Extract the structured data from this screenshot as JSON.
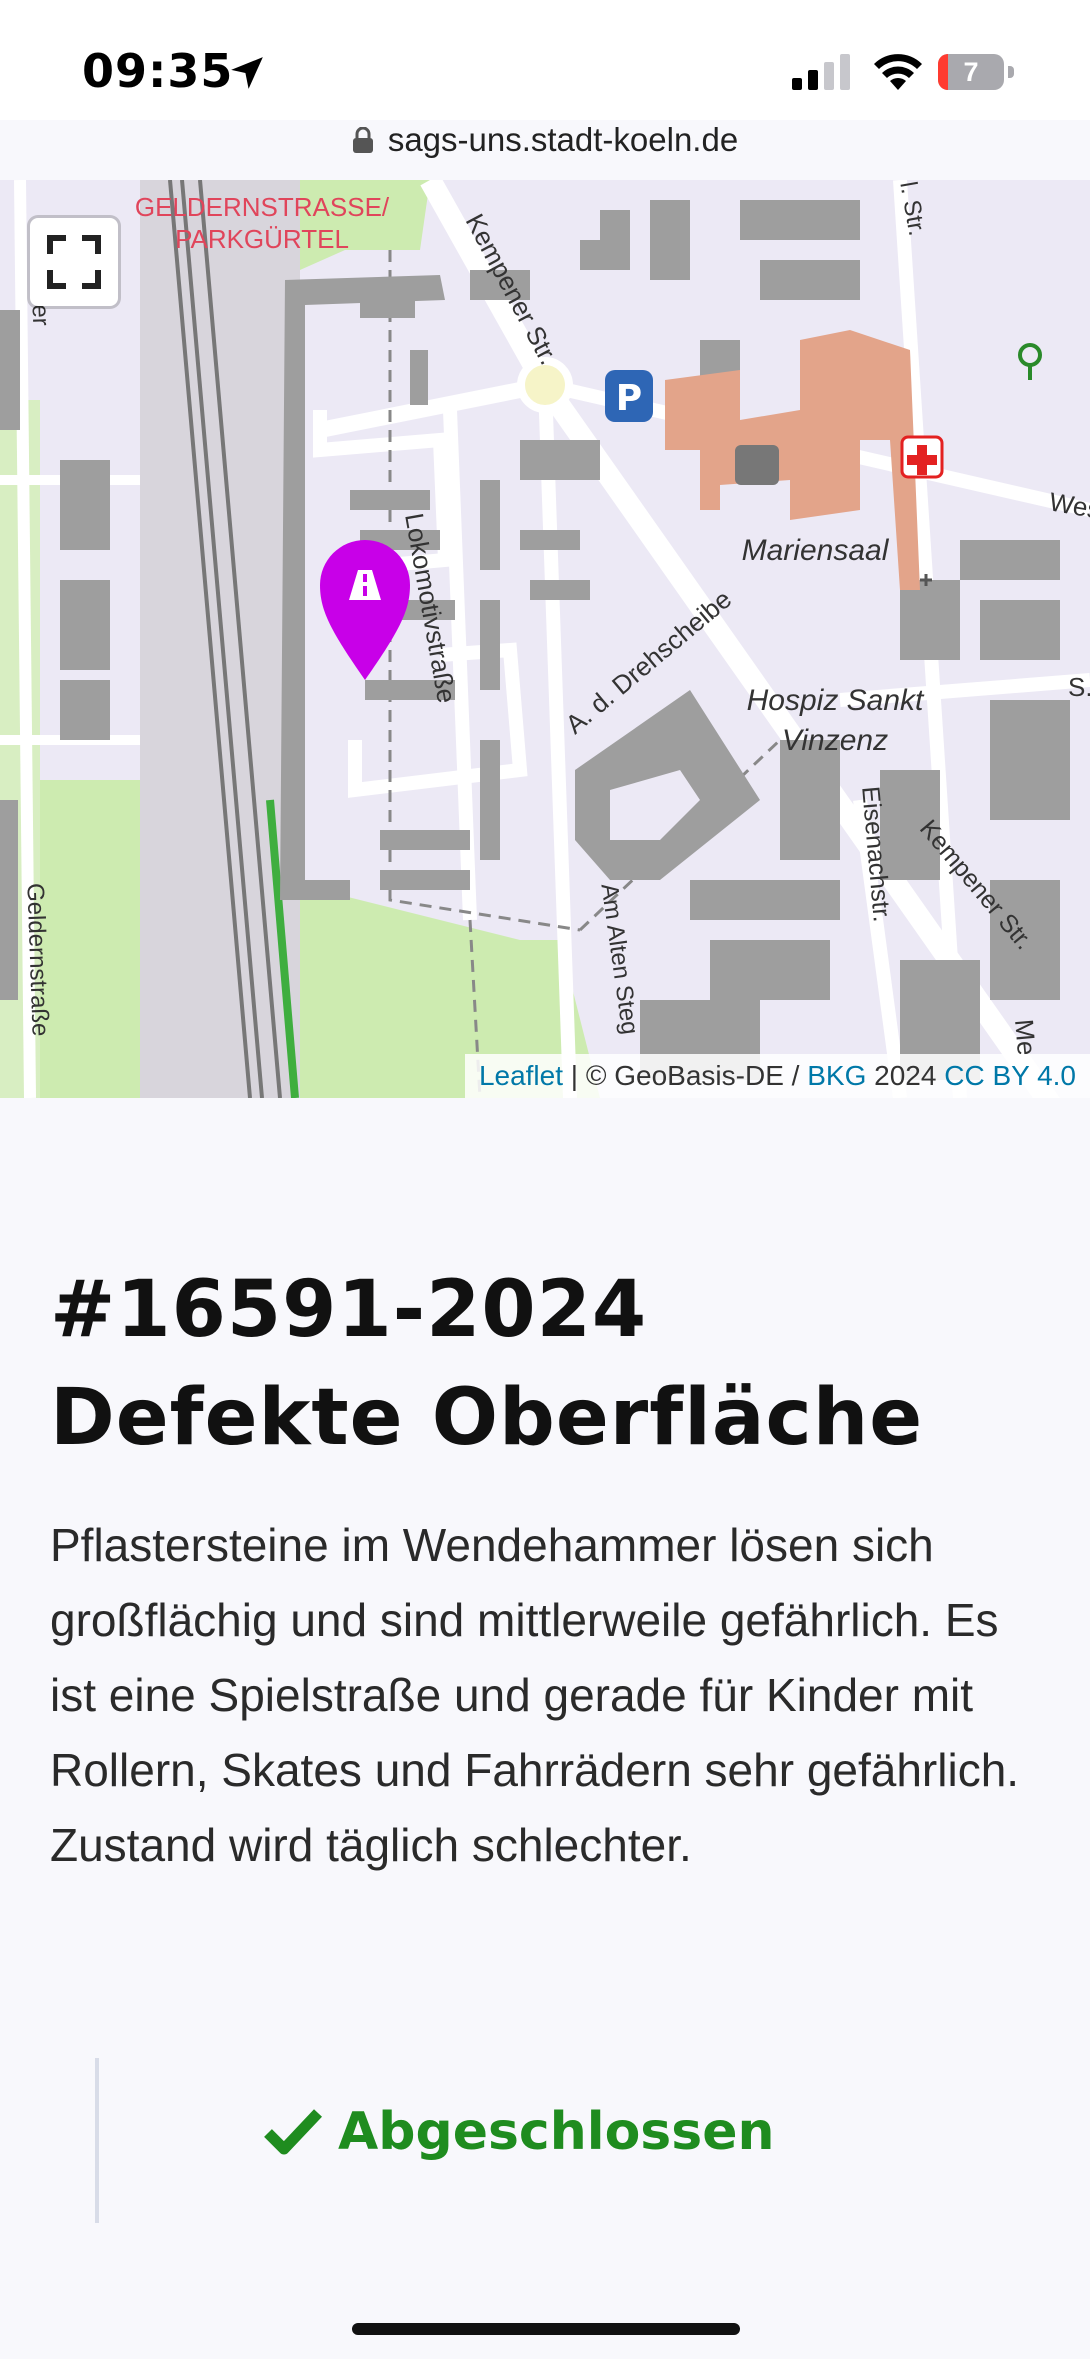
{
  "status_bar": {
    "time": "09:35",
    "battery": "7",
    "icons": [
      "location-arrow-icon",
      "cellular-signal-icon",
      "wifi-icon",
      "battery-icon"
    ]
  },
  "browser": {
    "url": "sags-uns.stadt-koeln.de",
    "lock_icon": "lock-icon"
  },
  "map": {
    "labels": {
      "area_name_line1": "GELDERNSTRASSE/",
      "area_name_line2": "PARKGÜRTEL",
      "kempener_str_top": "Kempener Str.",
      "lokomotivstrasse": "Lokomotivstraße",
      "drehscheibe": "A. d. Drehscheibe",
      "mariensaal": "Mariensaal",
      "hospiz_line1": "Hospiz Sankt",
      "hospiz_line2": "Vinzenz",
      "eisenachstr": "Eisenachstr.",
      "kempener_str_bottom": "Kempener Str.",
      "am_alten_steg": "Am Alten Steg",
      "geldernstrasse_left": "Geldernstraße",
      "gelder_top": "Gelder",
      "str_top": "l. Str.",
      "wes": "Wes",
      "s_right": "S.",
      "me": "Me"
    },
    "marker_icon": "road-marker-icon",
    "fullscreen_icon": "fullscreen-icon",
    "attribution": {
      "leaflet": "Leaflet",
      "separator": " | © GeoBasis-DE / ",
      "bkg": "BKG",
      "year": " 2024 ",
      "license": "CC BY 4.0"
    },
    "colors": {
      "marker": "#c800e8",
      "park": "#cdebb0",
      "building": "#9e9e9e",
      "hospital": "#e3a48a",
      "background": "#ece9f5"
    }
  },
  "report": {
    "id": "#16591-2024",
    "title": "Defekte Oberfläche",
    "description": "Pflastersteine im Wendehammer lösen sich großflächig und sind mittlerweile gefährlich. Es ist eine Spielstraße und gerade für Kinder mit Rollern, Skates und Fahrrädern sehr gefährlich. Zustand wird täglich schlechter.",
    "status": "Abgeschlossen",
    "status_icon": "checkmark-icon",
    "status_color": "#1f8c1f"
  }
}
